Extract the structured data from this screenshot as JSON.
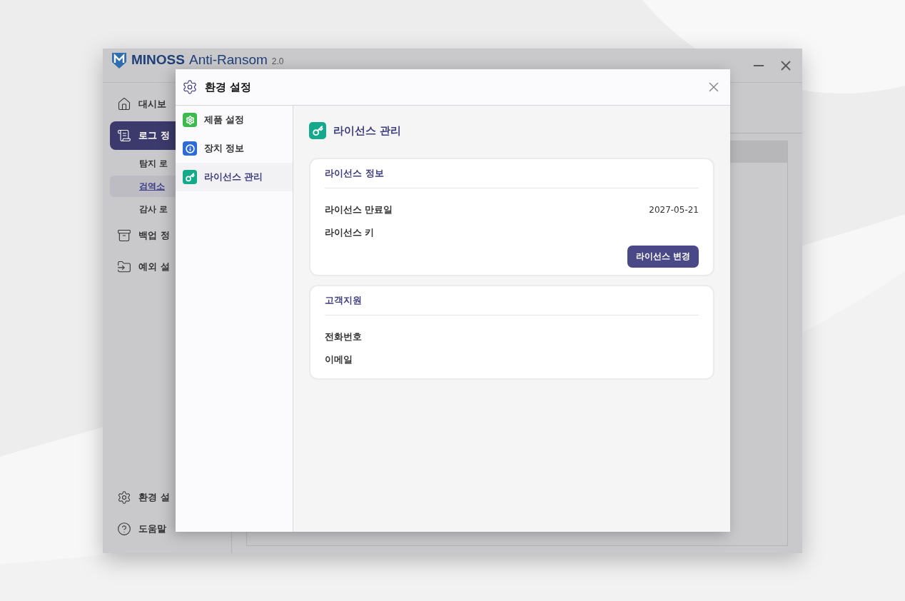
{
  "app": {
    "brand": "MINOSS",
    "product": "Anti-Ransom",
    "version": "2.0"
  },
  "sidebar": {
    "items": [
      {
        "label": "대시보",
        "kind": "home",
        "selected": false
      },
      {
        "label": "로그 정",
        "kind": "scroll",
        "selected": true,
        "children": [
          {
            "label": "탐지 로",
            "selected": false
          },
          {
            "label": "검역소",
            "selected": true
          },
          {
            "label": "감사 로",
            "selected": false
          }
        ]
      },
      {
        "label": "백업 정",
        "kind": "archive",
        "selected": false
      },
      {
        "label": "예외 설",
        "kind": "folder",
        "selected": false
      }
    ],
    "bottom_items": [
      {
        "label": "환경 설",
        "kind": "gear"
      },
      {
        "label": "도움말",
        "kind": "help"
      }
    ]
  },
  "dialog": {
    "title": "환경 설정",
    "nav": [
      {
        "label": "제품 설정",
        "kind": "gear",
        "selected": false
      },
      {
        "label": "장치 정보",
        "kind": "info",
        "selected": false
      },
      {
        "label": "라이선스 관리",
        "kind": "key",
        "selected": true
      }
    ],
    "heading": "라이선스 관리",
    "cards": [
      {
        "title": "라이선스 정보",
        "rows": [
          {
            "label": "라이선스 만료일",
            "value": "2027-05-21"
          },
          {
            "label": "라이선스 키"
          }
        ],
        "button": "라이선스 변경"
      },
      {
        "title": "고객지원",
        "rows": [
          {
            "label": "전화번호"
          },
          {
            "label": "이메일"
          }
        ]
      }
    ]
  }
}
